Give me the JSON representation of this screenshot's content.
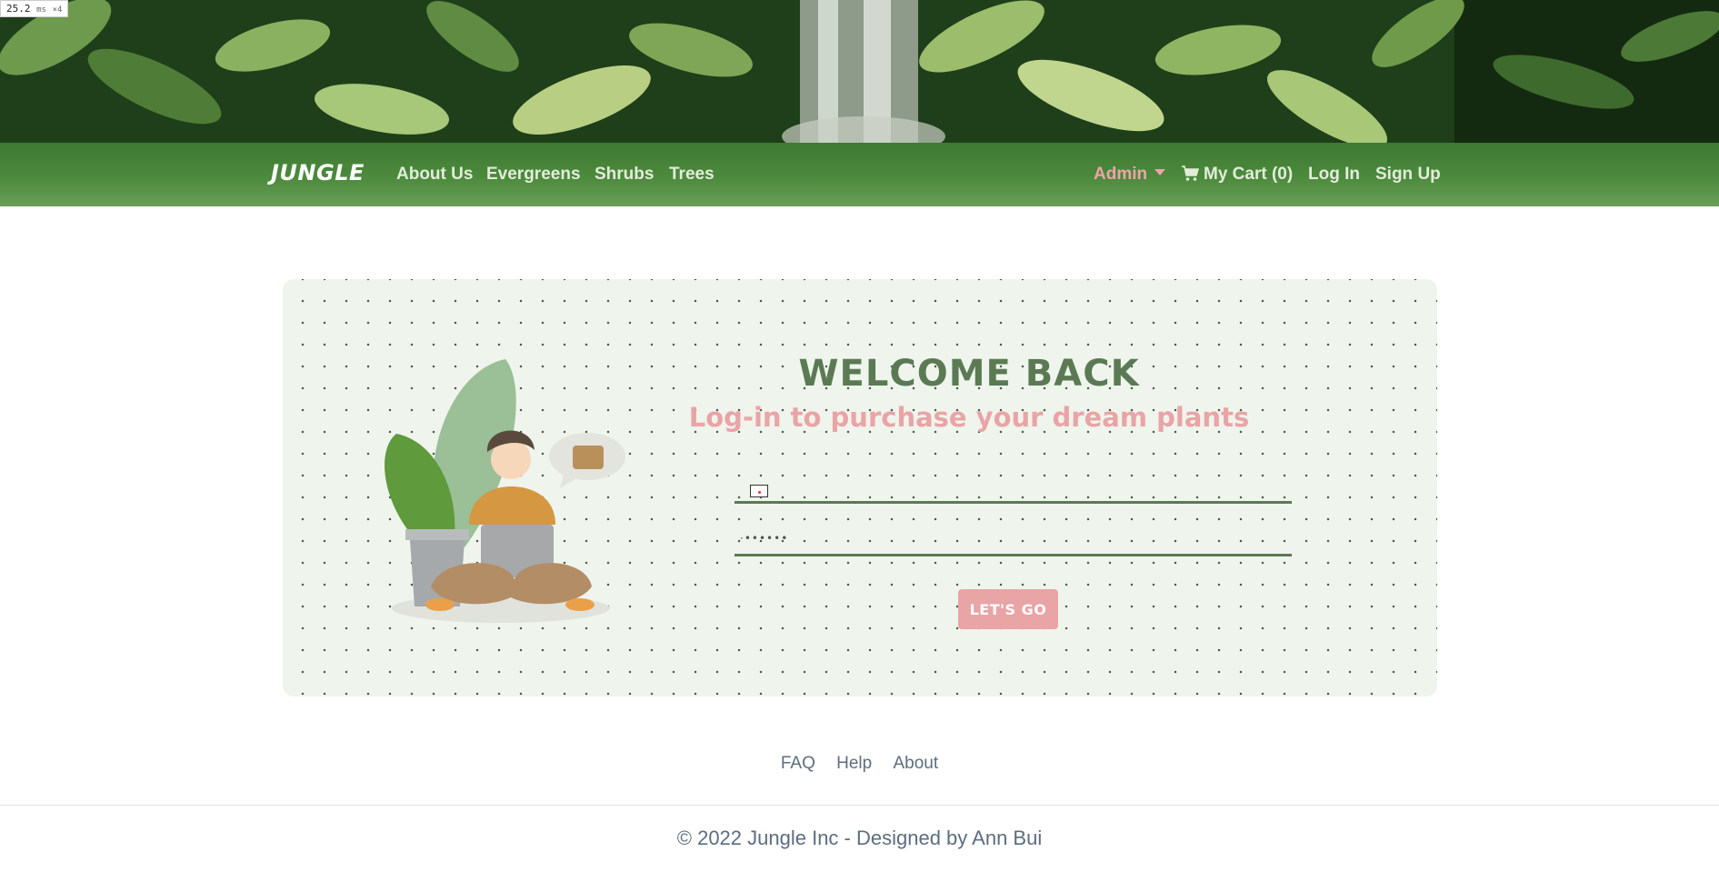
{
  "perf_badge": {
    "value": "25.2",
    "unit": "ms",
    "multiplier": "×4"
  },
  "navbar": {
    "brand": "JUNGLE",
    "links": [
      "About Us",
      "Evergreens",
      "Shrubs",
      "Trees"
    ],
    "admin": "Admin",
    "cart": "My Cart (0)",
    "login": "Log In",
    "signup": "Sign Up"
  },
  "login": {
    "title": "WELCOME BACK",
    "subtitle": "Log-in to purchase your dream plants",
    "email_placeholder": "",
    "password_mask": "·••••••",
    "submit_label": "LET'S GO"
  },
  "footer": {
    "links": [
      "FAQ",
      "Help",
      "About"
    ],
    "copyright": "© 2022 Jungle Inc - Designed by Ann Bui"
  },
  "colors": {
    "nav_green": "#4c8a3d",
    "accent_pink": "#e9a4a6",
    "heading_green": "#5b7a54",
    "card_bg": "#eff4ed"
  }
}
